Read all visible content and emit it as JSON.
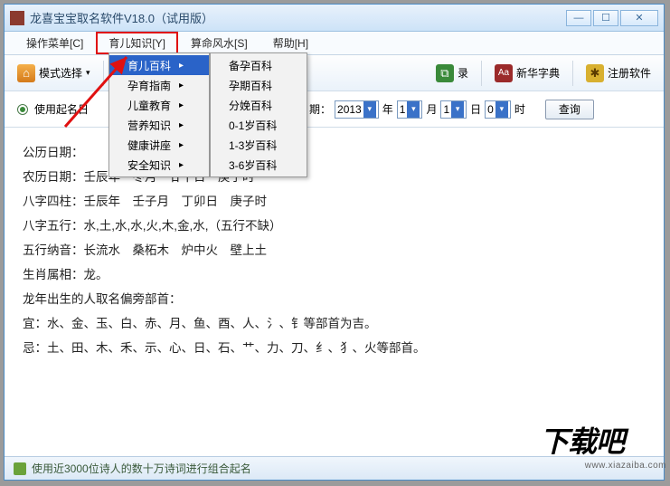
{
  "title": "龙喜宝宝取名软件V18.0（试用版）",
  "menubar": {
    "items": [
      {
        "label": "操作菜单[C]"
      },
      {
        "label": "育儿知识[Y]"
      },
      {
        "label": "算命风水[S]"
      },
      {
        "label": "帮助[H]"
      }
    ]
  },
  "toolbar": {
    "mode": "模式选择",
    "record": "录",
    "dict": "新华字典",
    "register": "注册软件"
  },
  "dropdown1": {
    "items": [
      {
        "label": "育儿百科",
        "hasSub": true,
        "hover": true
      },
      {
        "label": "孕育指南",
        "hasSub": true
      },
      {
        "label": "儿童教育",
        "hasSub": true
      },
      {
        "label": "营养知识",
        "hasSub": true
      },
      {
        "label": "健康讲座",
        "hasSub": true
      },
      {
        "label": "安全知识",
        "hasSub": true
      }
    ]
  },
  "dropdown2": {
    "items": [
      {
        "label": "备孕百科"
      },
      {
        "label": "孕期百科"
      },
      {
        "label": "分娩百科"
      },
      {
        "label": "0-1岁百科"
      },
      {
        "label": "1-3岁百科"
      },
      {
        "label": "3-6岁百科"
      }
    ]
  },
  "form": {
    "radio_label": "使用起名日",
    "birth_label": "出生日期：",
    "year": "2013",
    "year_unit": "年",
    "month": "1",
    "month_unit": "月",
    "day": "1",
    "day_unit": "日",
    "hour": "0",
    "hour_unit": "时",
    "query": "查询"
  },
  "content": {
    "l1": "公历日期：",
    "l2": "农历日期：壬辰年　冬月　廿十日　庚子时",
    "l3": "八字四柱：壬辰年　壬子月　丁卯日　庚子时",
    "l4": "八字五行：水,土,水,水,火,木,金,水,（五行不缺）",
    "l5": "五行纳音：长流水　桑柘木　炉中火　壁上土",
    "l6": "生肖属相：龙。",
    "l7": "龙年出生的人取名偏旁部首：",
    "l8": "宜：水、金、玉、白、赤、月、鱼、酉、人、氵、钅等部首为吉。",
    "l9": "忌：土、田、木、禾、示、心、日、石、艹、力、刀、纟、犭、火等部首。"
  },
  "status": "使用近3000位诗人的数十万诗词进行组合起名",
  "watermark": {
    "big": "下载吧",
    "url": "www.xiazaiba.com"
  }
}
